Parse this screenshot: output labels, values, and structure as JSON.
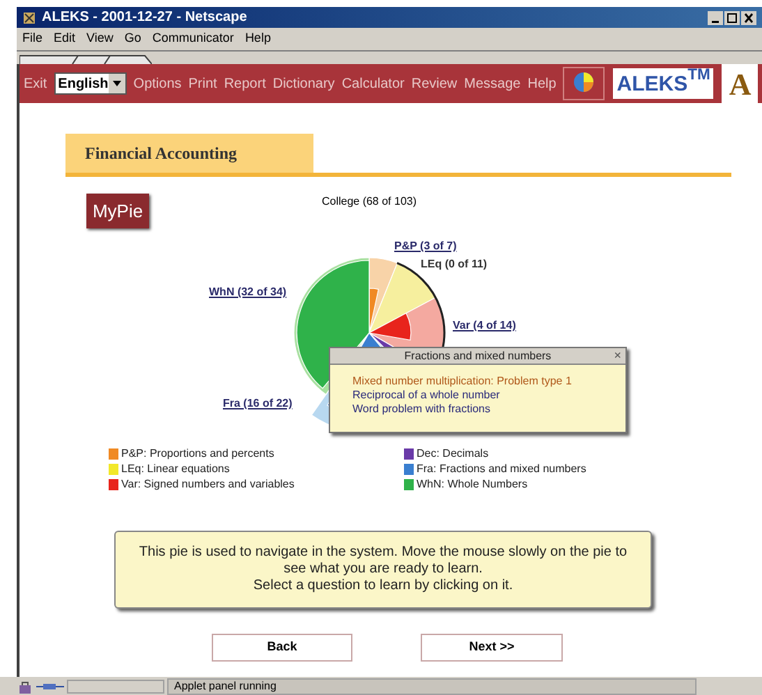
{
  "window": {
    "title": "ALEKS - 2001-12-27 - Netscape"
  },
  "menu": [
    "File",
    "Edit",
    "View",
    "Go",
    "Communicator",
    "Help"
  ],
  "nav": [
    {
      "kind": "link",
      "label": "Exit"
    },
    {
      "kind": "select",
      "value": "English"
    },
    {
      "kind": "link",
      "label": "Options"
    },
    {
      "kind": "link",
      "label": "Print"
    },
    {
      "kind": "link",
      "label": "Report"
    },
    {
      "kind": "link",
      "label": "Dictionary"
    },
    {
      "kind": "link",
      "label": "Calculator"
    },
    {
      "kind": "link",
      "label": "Review"
    },
    {
      "kind": "link",
      "label": "Message"
    },
    {
      "kind": "link",
      "label": "Help"
    }
  ],
  "logos": {
    "brand": "ALEKS$^{TM}$",
    "letter": "A"
  },
  "course_tab": "Financial Accounting",
  "mypie_badge": "MyPie",
  "pie": {
    "title": "College (68 of 103)",
    "labels": [
      {
        "text": "P&P (3 of 7)",
        "link": true
      },
      {
        "text": "LEq (0 of 11)",
        "link": false
      },
      {
        "text": "WhN (32 of 34)",
        "link": true
      },
      {
        "text": "Var (4 of 14)",
        "link": true
      },
      {
        "text": "Fra (16 of 22)",
        "link": true
      }
    ]
  },
  "popup": {
    "title": "Fractions and mixed numbers",
    "close": "×",
    "items": [
      {
        "text": "Mixed number multiplication: Problem type 1",
        "selected": true
      },
      {
        "text": "Reciprocal of a whole number",
        "selected": false
      },
      {
        "text": "Word problem with fractions",
        "selected": false
      }
    ]
  },
  "legend": [
    {
      "text": "P&P: Proportions and percents",
      "color": "#f08a24"
    },
    {
      "text": "LEq: Linear equations",
      "color": "#f2e82a"
    },
    {
      "text": "Var: Signed numbers and variables",
      "color": "#e8241c"
    },
    {
      "text": "Dec: Decimals",
      "color": "#6a3aa8"
    },
    {
      "text": "Fra: Fractions and mixed numbers",
      "color": "#3a7fd0"
    },
    {
      "text": "WhN: Whole Numbers",
      "color": "#2fb24a"
    }
  ],
  "note": [
    "This pie is used to navigate in the system. Move the mouse slowly on the pie to see what you are ready to learn.",
    "Select a question to learn by clicking on it."
  ],
  "buttons": [
    "Back",
    "Next >>"
  ],
  "status_bar": {
    "text": "Applet panel running"
  }
}
